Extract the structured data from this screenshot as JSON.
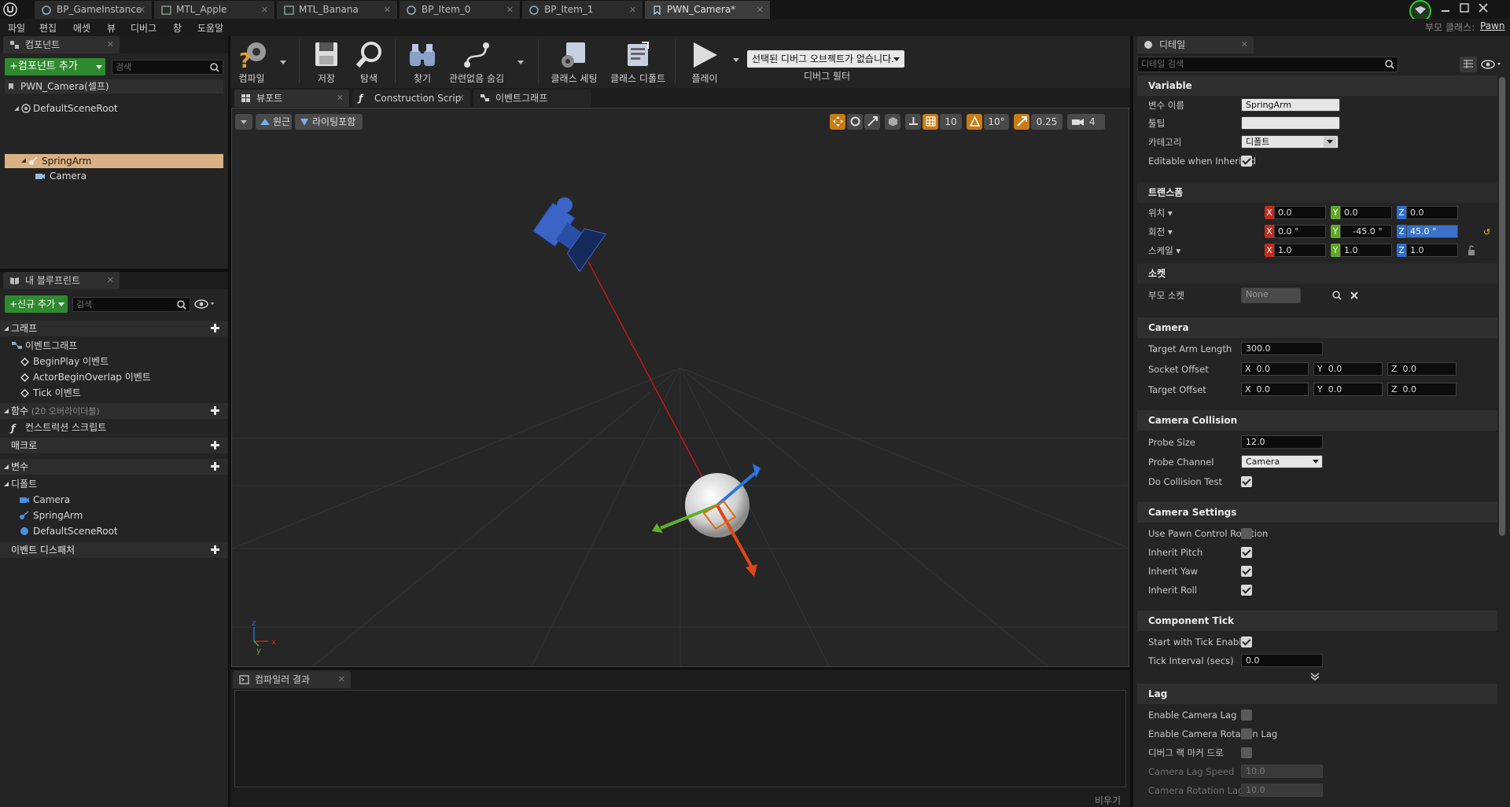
{
  "tabs": [
    {
      "label": "BP_GameInstance"
    },
    {
      "label": "MTL_Apple"
    },
    {
      "label": "MTL_Banana"
    },
    {
      "label": "BP_Item_0"
    },
    {
      "label": "BP_Item_1"
    },
    {
      "label": "PWN_Camera*"
    }
  ],
  "parent_class": {
    "label": "부모 클래스:",
    "value": "Pawn"
  },
  "menu": [
    "파일",
    "편집",
    "애셋",
    "뷰",
    "디버그",
    "창",
    "도움말"
  ],
  "components": {
    "tab": "컴포넌트",
    "add_button": "+컴포넌트 추가",
    "search_placeholder": "검색",
    "root_label": "PWN_Camera(셀프)",
    "items": [
      "DefaultSceneRoot",
      "SpringArm",
      "Camera"
    ]
  },
  "toolbar": {
    "compile": "컴파일",
    "save": "저장",
    "browse": "탐색",
    "find": "찾기",
    "hide_unrelated": "관련없음 숨김",
    "class_settings": "클래스 세팅",
    "class_defaults": "클래스 디폴트",
    "play": "플레이",
    "debug_select": "선택된 디버그 오브젝트가 없습니다.",
    "debug_filter": "디버그 필터"
  },
  "editor_tabs": [
    "뷰포트",
    "Construction Scrip",
    "이벤트그래프"
  ],
  "viewport": {
    "perspective": "원근",
    "lighting": "라이팅포함",
    "grid_snap": "10",
    "rot_snap": "10°",
    "scale_snap": "0.25",
    "cam_speed": "4"
  },
  "my_blueprint": {
    "tab": "내 블루프린트",
    "new_button": "+신규 추가",
    "search_placeholder": "검색",
    "graph_section": "그래프",
    "event_graph": "이벤트그래프",
    "events": [
      "BeginPlay 이벤트",
      "ActorBeginOverlap 이벤트",
      "Tick 이벤트"
    ],
    "functions_section": "함수",
    "functions_note": "(20 오버라이더블)",
    "construction_script": "컨스트럭션 스크립트",
    "macros_section": "매크로",
    "variables_section": "변수",
    "default_category": "디폴트",
    "variables": [
      "Camera",
      "SpringArm",
      "DefaultSceneRoot"
    ],
    "dispatchers_section": "이벤트 디스패처"
  },
  "compiler": {
    "tab": "컴파일러 결과",
    "clear": "비우기"
  },
  "details": {
    "tab": "디테일",
    "search_placeholder": "디테일 검색",
    "variable_section": "Variable",
    "var_name_label": "변수 이름",
    "var_name": "SpringArm",
    "tooltip_label": "툴팁",
    "category_label": "카테고리",
    "category": "디폴트",
    "editable_inherited": "Editable when Inherited",
    "transform_section": "트랜스폼",
    "location_label": "위치",
    "rotation_label": "회전",
    "scale_label": "스케일",
    "location": {
      "x": "0.0",
      "y": "0.0",
      "z": "0.0"
    },
    "rotation": {
      "x": "0.0 °",
      "y": "-45.0 °",
      "z": "45.0 °"
    },
    "scale": {
      "x": "1.0",
      "y": "1.0",
      "z": "1.0"
    },
    "socket_section": "소켓",
    "parent_socket_label": "부모 소켓",
    "parent_socket": "None",
    "camera_section": "Camera",
    "target_arm_length_label": "Target Arm Length",
    "target_arm_length": "300.0",
    "socket_offset_label": "Socket Offset",
    "socket_offset": {
      "x": "0.0",
      "y": "0.0",
      "z": "0.0"
    },
    "target_offset_label": "Target Offset",
    "target_offset": {
      "x": "0.0",
      "y": "0.0",
      "z": "0.0"
    },
    "collision_section": "Camera Collision",
    "probe_size_label": "Probe Size",
    "probe_size": "12.0",
    "probe_channel_label": "Probe Channel",
    "probe_channel": "Camera",
    "do_collision_label": "Do Collision Test",
    "settings_section": "Camera Settings",
    "use_pawn_rot": "Use Pawn Control Rotation",
    "inherit_pitch": "Inherit Pitch",
    "inherit_yaw": "Inherit Yaw",
    "inherit_roll": "Inherit Roll",
    "tick_section": "Component Tick",
    "start_tick": "Start with Tick Enabled",
    "tick_interval_label": "Tick Interval (secs)",
    "tick_interval": "0.0",
    "lag_section": "Lag",
    "enable_lag": "Enable Camera Lag",
    "enable_rot_lag": "Enable Camera Rotation Lag",
    "debug_marker": "디버그 랙 마커 드로",
    "lag_speed_label": "Camera Lag Speed",
    "lag_speed": "10.0",
    "rot_lag_speed_label": "Camera Rotation Lag Speed",
    "rot_lag_speed": "10.0"
  },
  "colors": {
    "accent_green": "#2f8a2f",
    "selection": "#d9b184",
    "axis_x": "#c42b1c",
    "axis_y": "#5fa827",
    "axis_z": "#2a6fd6"
  }
}
